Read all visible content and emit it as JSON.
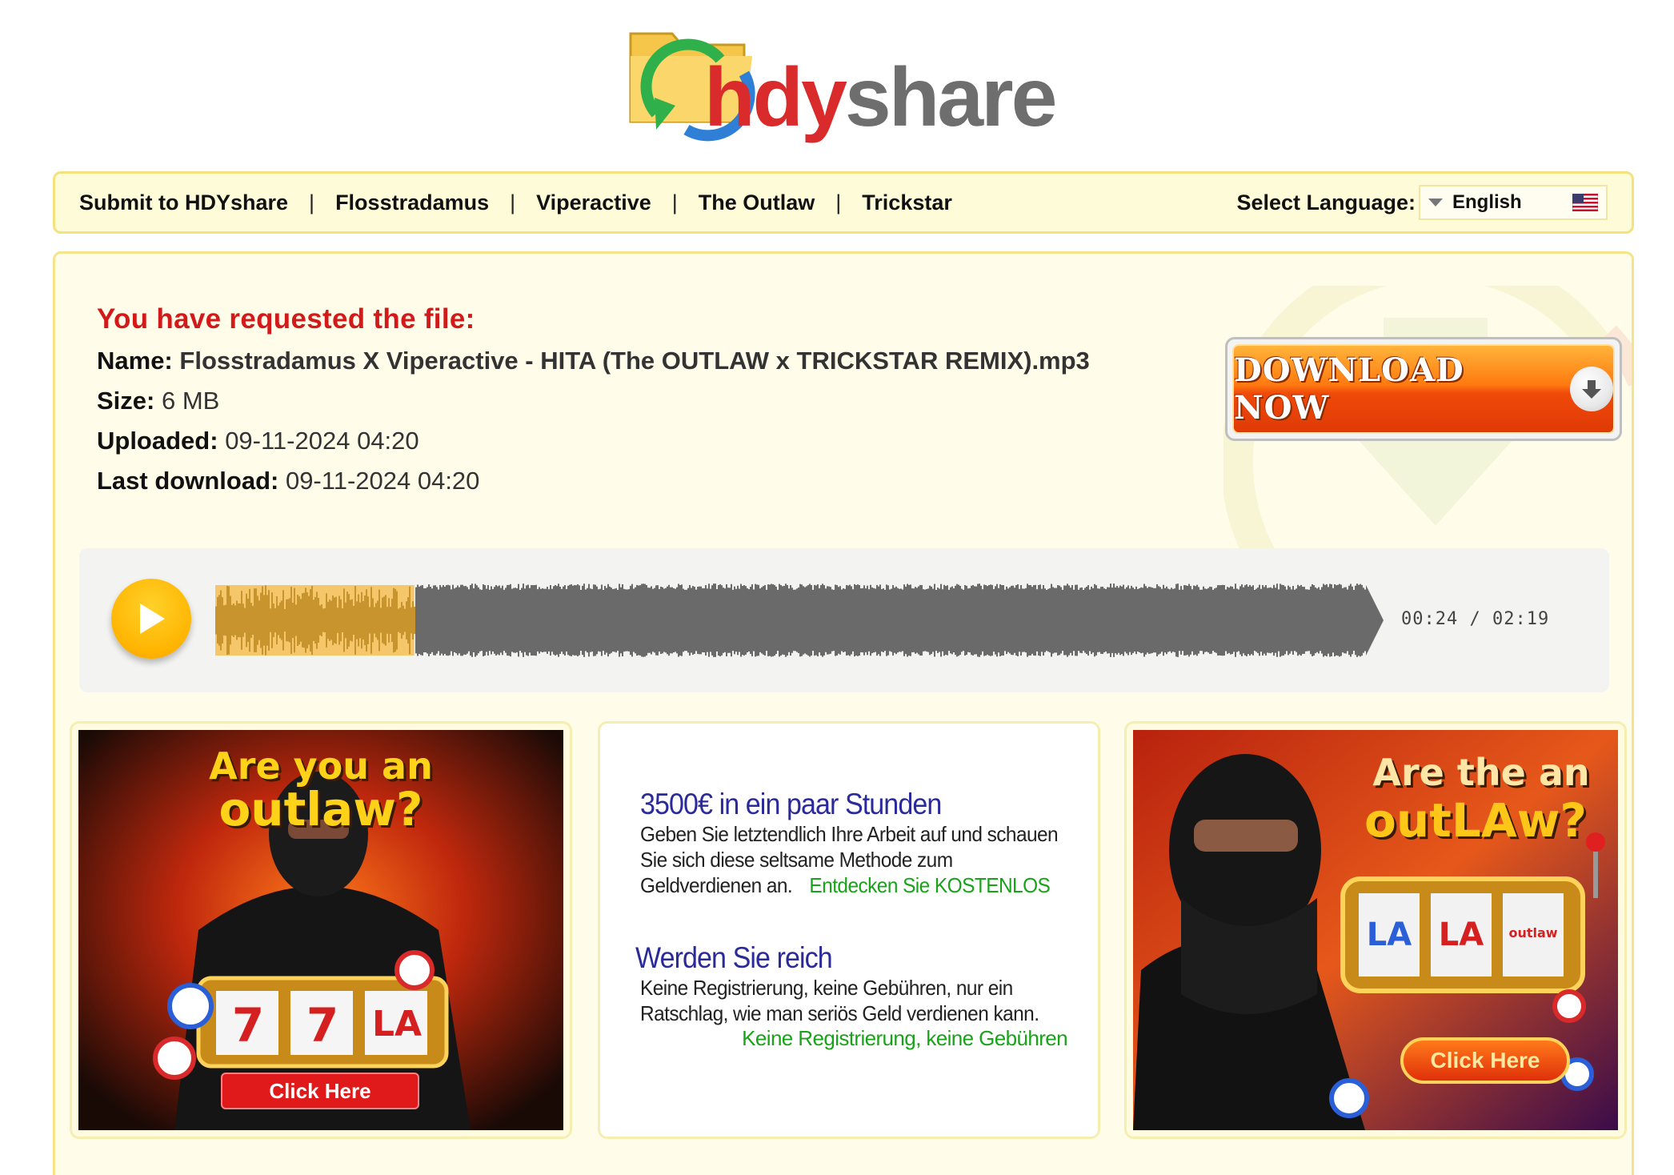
{
  "logo": {
    "hd": "hd",
    "y": "y",
    "share": "share"
  },
  "nav": {
    "links": [
      "Submit to HDYshare",
      "Flosstradamus",
      "Viperactive",
      "The Outlaw",
      "Trickstar"
    ],
    "separator": "|",
    "language_label": "Select Language:",
    "language_value": "English"
  },
  "file": {
    "heading": "You have requested the file:",
    "name_label": "Name:",
    "name_value": "Flosstradamus X Viperactive - HITA (The OUTLAW x TRICKSTAR REMIX).mp3",
    "size_label": "Size:",
    "size_value": "6 MB",
    "uploaded_label": "Uploaded:",
    "uploaded_value": "09-11-2024 04:20",
    "last_download_label": "Last download:",
    "last_download_value": "09-11-2024 04:20"
  },
  "download_button": {
    "label": "DOWNLOAD NOW"
  },
  "player": {
    "current_time": "00:24",
    "duration": "02:19",
    "time_display": "00:24 / 02:19",
    "progress_fraction": 0.173
  },
  "ads": {
    "left": {
      "headline_line1": "Are you an",
      "headline_line2": "outlaw?",
      "cta": "Click Here",
      "reels": [
        "7",
        "7",
        "LA"
      ]
    },
    "middle": {
      "block1_title": "3500€ in ein paar Stunden",
      "block1_body": "Geben Sie letztendlich Ihre Arbeit auf und schauen Sie sich diese seltsame Methode zum Geldverdienen an.",
      "block1_link": "Entdecken Sie KOSTENLOS",
      "block2_title": "Werden Sie reich",
      "block2_body": "Keine Registrierung, keine Gebühren, nur ein Ratschlag, wie man seriös Geld verdienen kann.",
      "block2_link": "Keine Registrierung, keine Gebühren"
    },
    "right": {
      "headline_line1": "Are the an",
      "headline_line2": "outLAw?",
      "cta": "Click Here",
      "reels": [
        "LA",
        "LA",
        "outlaw"
      ]
    }
  },
  "colors": {
    "nav_bg": "#fefbd9",
    "panel_bg": "#fffde9",
    "heading_red": "#d21a1a",
    "wave_played": "#c8942e",
    "wave_unplayed": "#6a6a6a",
    "ad_title_blue": "#2a2a9a",
    "ad_link_green": "#19a319"
  },
  "icons": {
    "logo": "folder-refresh-logo-icon",
    "flag": "us-flag-icon",
    "download": "arrow-down-circle-icon",
    "play": "play-icon",
    "caret": "caret-down-icon"
  }
}
